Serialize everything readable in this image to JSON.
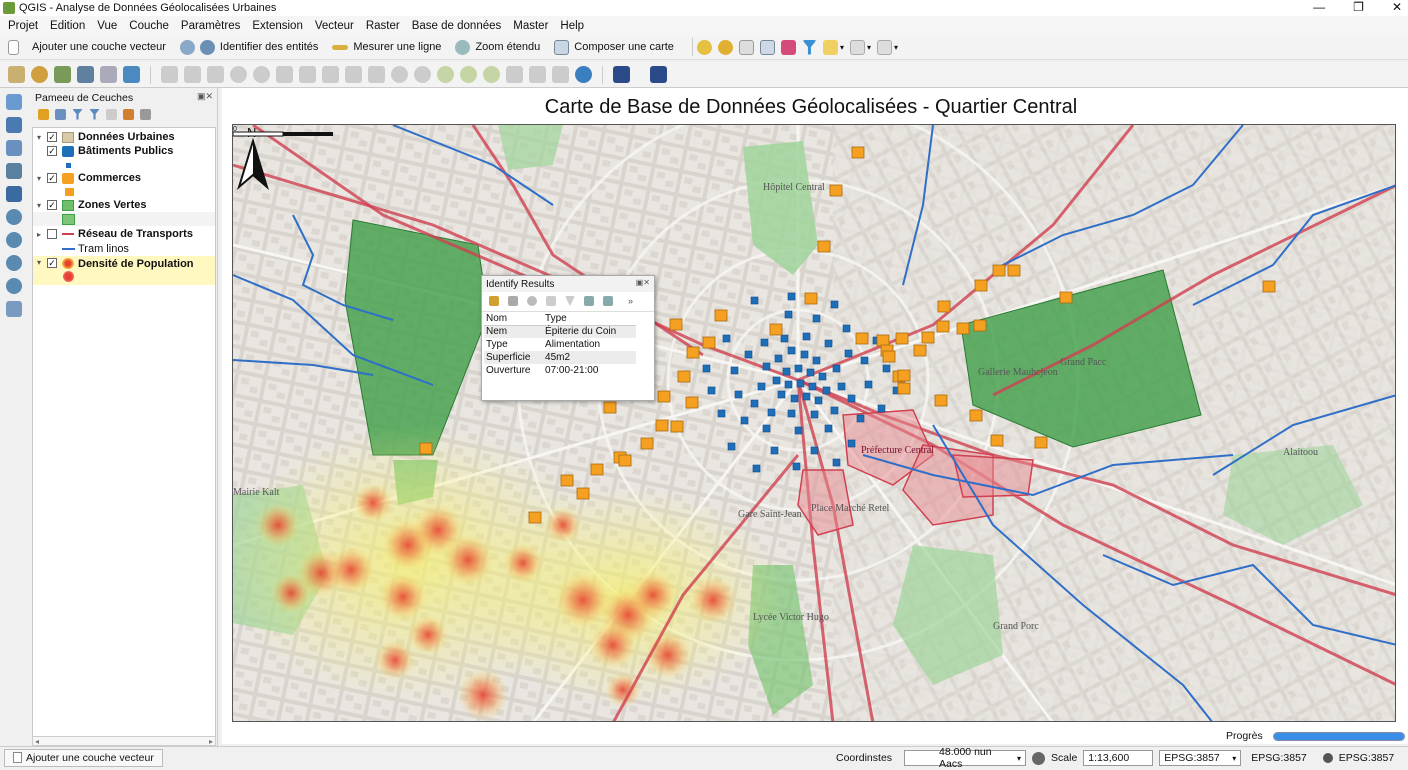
{
  "window": {
    "title": "QGIS - Analyse de Données Géolocalisées Urbaines"
  },
  "menu": [
    "Projet",
    "Edition",
    "Vue",
    "Couche",
    "Paramètres",
    "Extension",
    "Vecteur",
    "Raster",
    "Base de données",
    "Master",
    "Help"
  ],
  "toolbar": {
    "add_vector": "Ajouter une couche vecteur",
    "identify": "Identifier des entités",
    "measure": "Mesurer une ligne",
    "zoom_extent": "Zoom étendu",
    "composer": "Composer une carte"
  },
  "layers_panel": {
    "title": "Pameeu de Ceuches",
    "items": [
      {
        "label": "Données Urbaines",
        "group": true
      },
      {
        "label": "Bâtiments Publics",
        "checked": true
      },
      {
        "label": "Commerces",
        "checked": true
      },
      {
        "label": "Zones Vertes",
        "checked": true
      },
      {
        "label": "Réseau de Transports",
        "checked": false
      },
      {
        "label": "Tram linos",
        "legend": true
      },
      {
        "label": "Densité de Population",
        "checked": true,
        "selected": true
      }
    ]
  },
  "map": {
    "title": "Carte de Base de Données Géolocalisées - Quartier Central",
    "labels": {
      "hopital": "Hôpitel Central",
      "grand_parc": "Grand Pacc",
      "gallerie": "Gallerie Mauhcjeon",
      "prefecture": "Préfecture Central",
      "place": "Place Marché Retel",
      "gare": "Gare Saint-Jean",
      "lycee": "Lycée Victor Hugo",
      "grand_porc": "Grand Porc",
      "alaitoou": "Alaitoou",
      "mairie": "Mairie Kalt"
    },
    "colors": {
      "buildings": "#1f6fb8",
      "shops": "#f5a020",
      "green": "#3e9f48",
      "transport": "#d04050",
      "density": "#e84030"
    }
  },
  "identify": {
    "title": "Identify Results",
    "columns": [
      "Nom",
      "Type"
    ],
    "rows": [
      {
        "k": "Nem",
        "v": "Épiterie du Coin"
      },
      {
        "k": "Type",
        "v": "Alimentation"
      },
      {
        "k": "Superficie",
        "v": "45m2"
      },
      {
        "k": "Ouverture",
        "v": "07:00-21:00"
      }
    ]
  },
  "north_label": "N",
  "scale_zero": "0",
  "progress": {
    "label": "Progrès",
    "value": 1.0
  },
  "status": {
    "left": "Ajouter une couche vecteur",
    "coord_label": "Coordinstes",
    "coord_value": "48.000 nun Aacs",
    "scale_label": "Scale",
    "scale_value": "1:13,600",
    "crs_box": "EPSG:3857",
    "crs_text": "EPSG:3857",
    "crs_text2": "EPSG:3857"
  }
}
